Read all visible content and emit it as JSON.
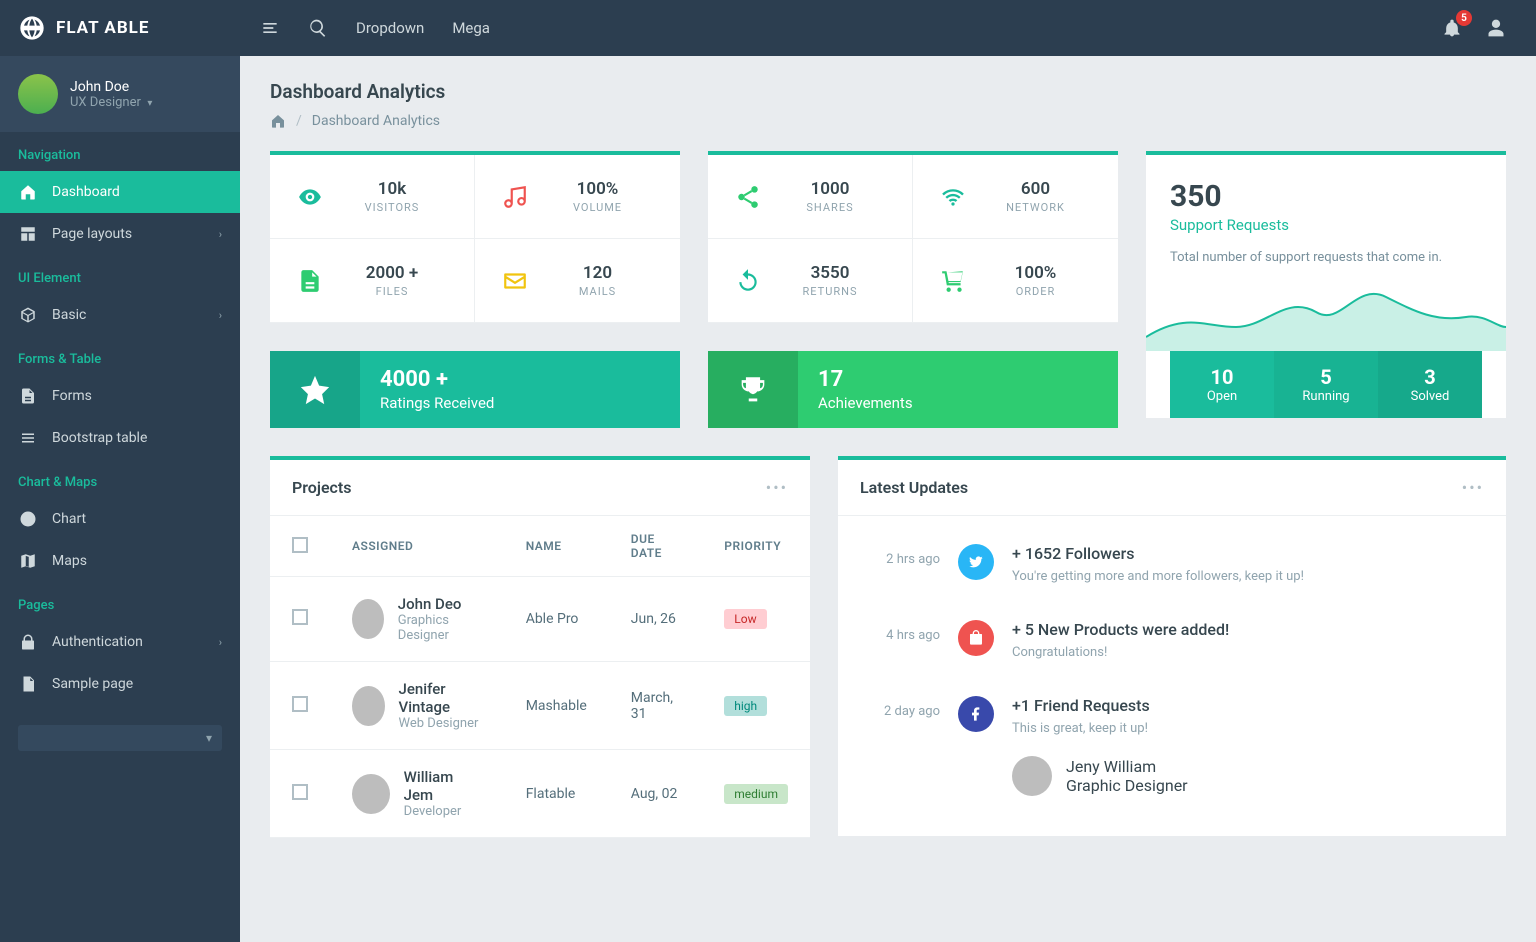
{
  "brand": "FLAT ABLE",
  "topnav": {
    "dropdown": "Dropdown",
    "mega": "Mega",
    "badge": "5"
  },
  "user": {
    "name": "John Doe",
    "role": "UX Designer"
  },
  "sidebar": {
    "sections": [
      {
        "header": "Navigation",
        "items": [
          {
            "label": "Dashboard",
            "icon": "home",
            "active": true
          },
          {
            "label": "Page layouts",
            "icon": "layout",
            "arrow": true
          }
        ]
      },
      {
        "header": "UI Element",
        "items": [
          {
            "label": "Basic",
            "icon": "cube",
            "arrow": true
          }
        ]
      },
      {
        "header": "Forms & Table",
        "items": [
          {
            "label": "Forms",
            "icon": "file"
          },
          {
            "label": "Bootstrap table",
            "icon": "list"
          }
        ]
      },
      {
        "header": "Chart & Maps",
        "items": [
          {
            "label": "Chart",
            "icon": "clock"
          },
          {
            "label": "Maps",
            "icon": "map"
          }
        ]
      },
      {
        "header": "Pages",
        "items": [
          {
            "label": "Authentication",
            "icon": "lock",
            "arrow": true
          },
          {
            "label": "Sample page",
            "icon": "page"
          }
        ]
      }
    ]
  },
  "page": {
    "title": "Dashboard Analytics",
    "crumb": "Dashboard Analytics"
  },
  "statsA": [
    {
      "value": "10k",
      "label": "VISITORS",
      "icon": "eye",
      "color": "#1abc9c"
    },
    {
      "value": "100%",
      "label": "VOLUME",
      "icon": "music",
      "color": "#ef5350"
    },
    {
      "value": "2000 +",
      "label": "FILES",
      "icon": "file",
      "color": "#2ecc71"
    },
    {
      "value": "120",
      "label": "MAILS",
      "icon": "mail",
      "color": "#f1c40f"
    }
  ],
  "statsB": [
    {
      "value": "1000",
      "label": "SHARES",
      "icon": "share",
      "color": "#2ecc71"
    },
    {
      "value": "600",
      "label": "NETWORK",
      "icon": "wifi",
      "color": "#1abc9c"
    },
    {
      "value": "3550",
      "label": "RETURNS",
      "icon": "undo",
      "color": "#1abc9c"
    },
    {
      "value": "100%",
      "label": "ORDER",
      "icon": "cart",
      "color": "#2ecc71"
    }
  ],
  "support": {
    "value": "350",
    "label": "Support Requests",
    "desc": "Total number of support requests that come in.",
    "tabs": [
      {
        "n": "10",
        "l": "Open"
      },
      {
        "n": "5",
        "l": "Running"
      },
      {
        "n": "3",
        "l": "Solved"
      }
    ]
  },
  "highlights": [
    {
      "value": "4000 +",
      "label": "Ratings Received",
      "icon": "star"
    },
    {
      "value": "17",
      "label": "Achievements",
      "icon": "trophy"
    }
  ],
  "projects": {
    "title": "Projects",
    "cols": [
      "ASSIGNED",
      "NAME",
      "DUE DATE",
      "PRIORITY"
    ],
    "rows": [
      {
        "person": "John Deo",
        "role": "Graphics Designer",
        "name": "Able Pro",
        "due": "Jun, 26",
        "priority": "Low",
        "pcls": "tag-low"
      },
      {
        "person": "Jenifer Vintage",
        "role": "Web Designer",
        "name": "Mashable",
        "due": "March, 31",
        "priority": "high",
        "pcls": "tag-high"
      },
      {
        "person": "William Jem",
        "role": "Developer",
        "name": "Flatable",
        "due": "Aug, 02",
        "priority": "medium",
        "pcls": "tag-med"
      }
    ]
  },
  "updates": {
    "title": "Latest Updates",
    "items": [
      {
        "time": "2 hrs ago",
        "badge": "tw",
        "title": "+ 1652 Followers",
        "desc": "You're getting more and more followers, keep it up!"
      },
      {
        "time": "4 hrs ago",
        "badge": "bag",
        "title": "+ 5 New Products were added!",
        "desc": "Congratulations!"
      },
      {
        "time": "2 day ago",
        "badge": "fb",
        "title": "+1 Friend Requests",
        "desc": "This is great, keep it up!",
        "person": {
          "name": "Jeny William",
          "role": "Graphic Designer"
        }
      }
    ]
  }
}
